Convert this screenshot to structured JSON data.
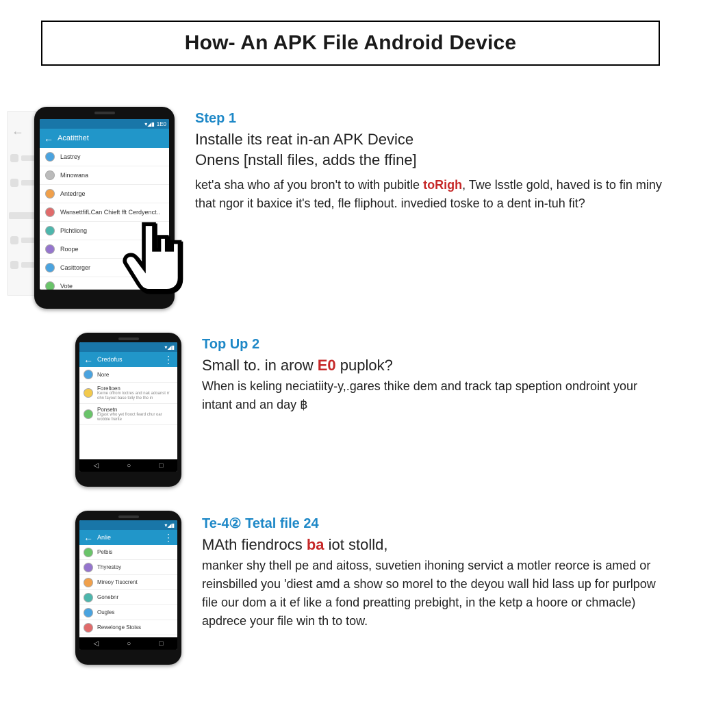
{
  "title": "How- An APK File Android Device",
  "steps": [
    {
      "label": "Step 1",
      "subhead": "Installe its reat in-an APK Device",
      "subhead2": "Onens [nstall files, adds the ffine]",
      "body_before_red": "ket'a sha who af you bron't to with pubitle ",
      "body_red": "toRigh",
      "body_after_red": ", Twe lsstle gold, haved is to fin miny that ngor it baxice it's ted, fle fliphout. invedied toske to a dent in-tuh fit?"
    },
    {
      "label": "Top Up 2",
      "subhead_before": "Small to. in arow ",
      "subhead_red": "E0",
      "subhead_after": " puplok?",
      "body": "When is keling neciatiity-y,.gares thike dem and track tap speption ondroint your intant and an day ฿"
    },
    {
      "label": "Te-4② Tetal file 24",
      "subhead_before": "MAth fiendrocs ",
      "subhead_red": "ba",
      "subhead_after": " iot stolld,",
      "body": "manker shy thell pe and aitoss, suvetien ihoning servict a motler reorce is amed or reinsbilled you 'diest amd a show so morel to the deyou wall hid lass up for purlpow file our dom a it ef like a fond preatting prebight, in the ketp a hoore or chmacle) apdrece your file win th to tow."
    }
  ],
  "phone1": {
    "header": "Acatitthet",
    "items": [
      "Lastrey",
      "Minowana",
      "Antedrge",
      "WansettfifLCan Chieft fft Cerdyenct..",
      "Plchtliong",
      "Roope",
      "Casittorger",
      "Vote"
    ]
  },
  "phone2": {
    "header": "Credofus",
    "items": [
      {
        "t": "Nore",
        "s": ""
      },
      {
        "t": "Foreltoen",
        "s": "Kerne offrom loctres and nak adoanst rr ohn fayout base tolly the the in"
      },
      {
        "t": "Ponsetn",
        "s": "Eigast who yet frooct feard chur oar wobble frerlte"
      }
    ]
  },
  "phone3": {
    "header": "Anlie",
    "items": [
      "Petbis",
      "Thyrestoy",
      "Mireoy  Tisocrent",
      "Gonebnr",
      "Ougles",
      "Rewelonge Stoiss"
    ]
  }
}
